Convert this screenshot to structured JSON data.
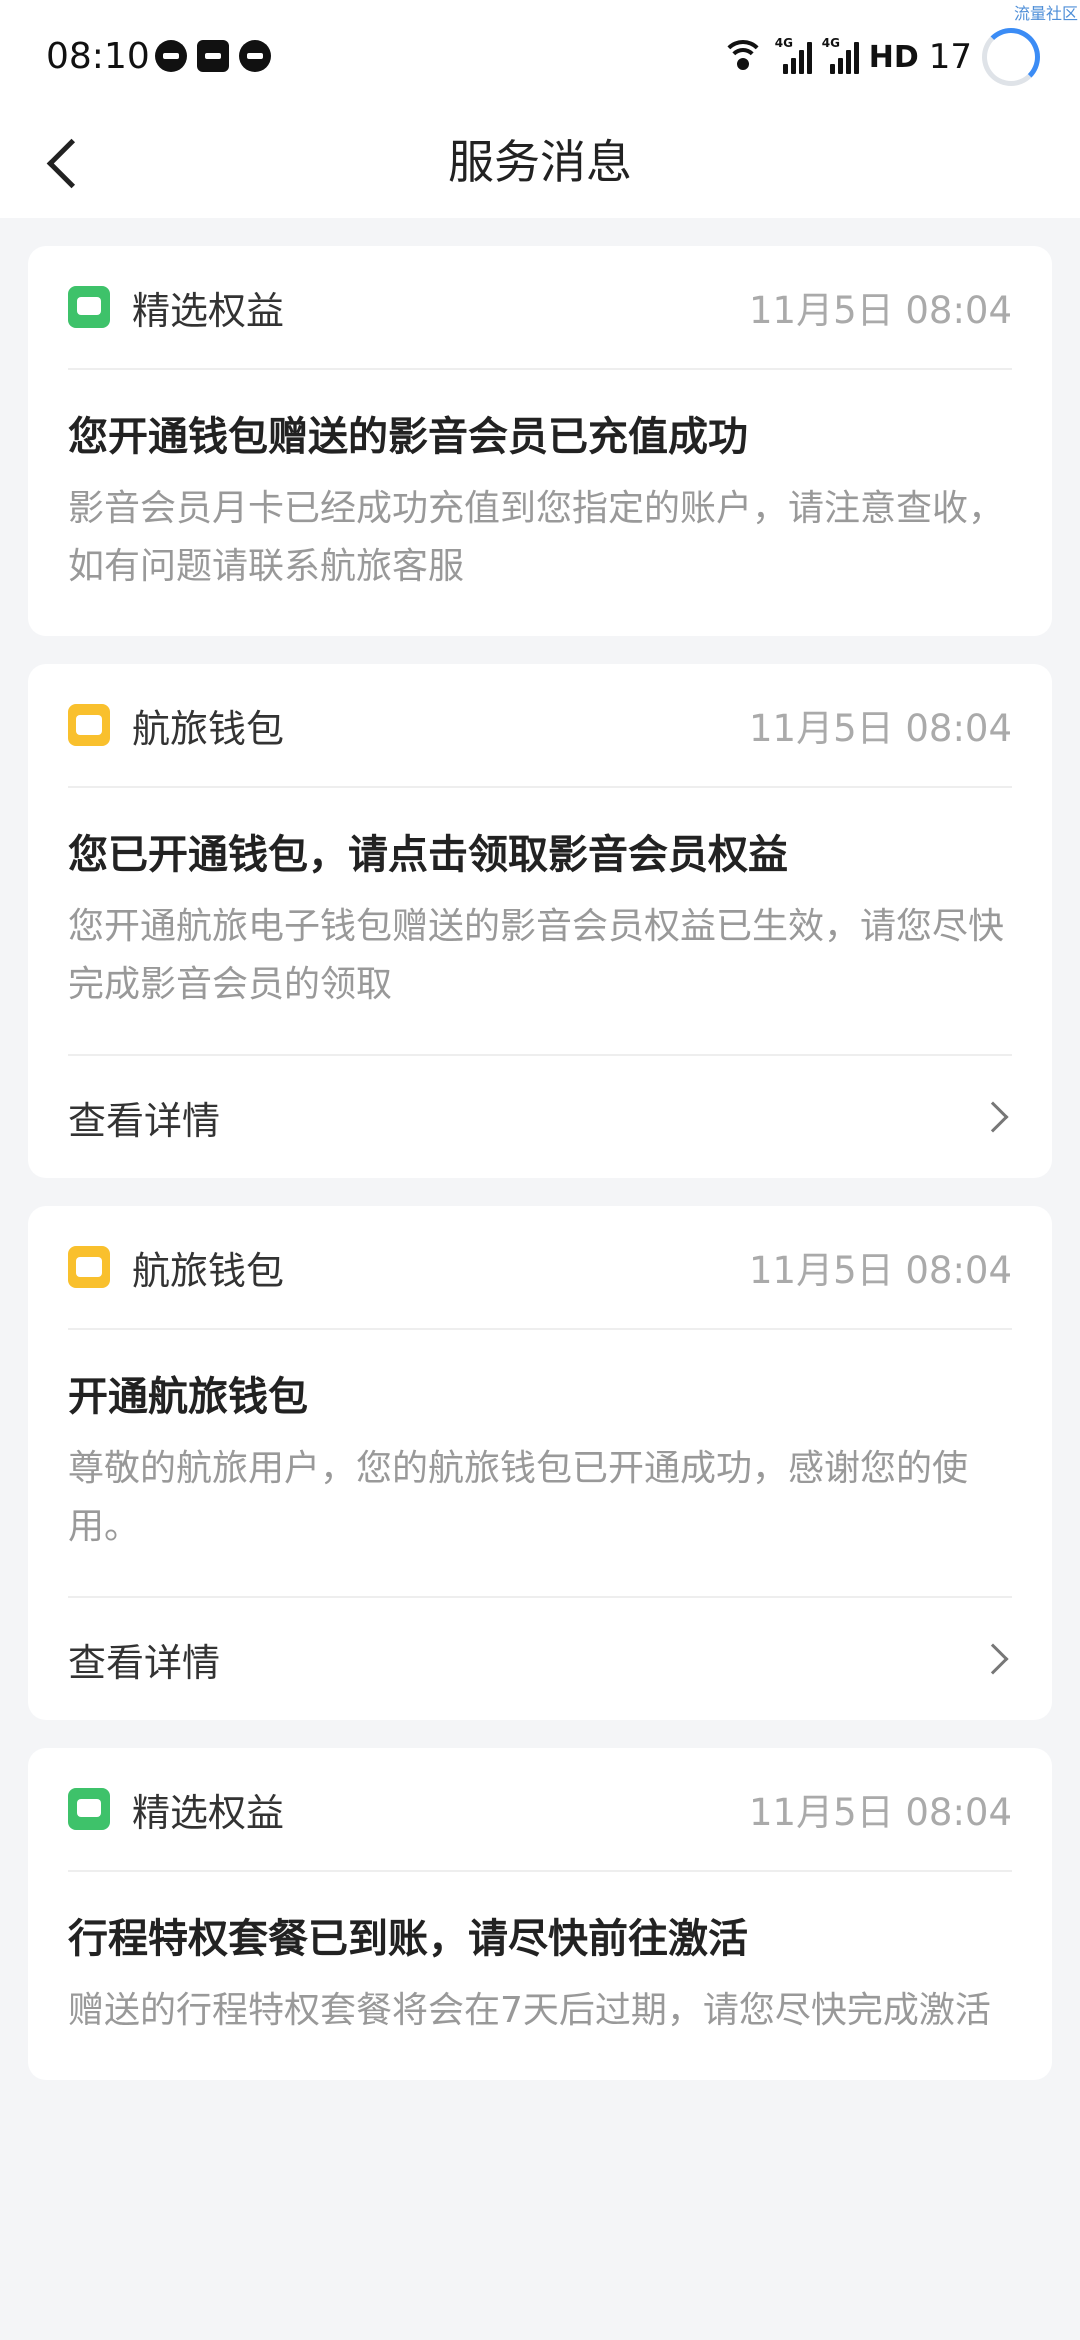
{
  "status_bar": {
    "time": "08:10",
    "hd_label": "HD",
    "battery": "17",
    "net_tags": [
      "4G",
      "4G"
    ],
    "watermark": "流量社区"
  },
  "nav": {
    "title": "服务消息"
  },
  "messages": [
    {
      "source": "精选权益",
      "icon": "green-chat-icon",
      "time": "11月5日 08:04",
      "title": "您开通钱包赠送的影音会员已充值成功",
      "text": "影音会员月卡已经成功充值到您指定的账户，请注意查收，如有问题请联系航旅客服"
    },
    {
      "source": "航旅钱包",
      "icon": "yellow-wallet-icon",
      "time": "11月5日 08:04",
      "title": "您已开通钱包，请点击领取影音会员权益",
      "text": "您开通航旅电子钱包赠送的影音会员权益已生效，请您尽快完成影音会员的领取",
      "detail_label": "查看详情"
    },
    {
      "source": "航旅钱包",
      "icon": "yellow-wallet-icon",
      "time": "11月5日 08:04",
      "title": "开通航旅钱包",
      "text": "尊敬的航旅用户，您的航旅钱包已开通成功，感谢您的使用。",
      "detail_label": "查看详情"
    },
    {
      "source": "精选权益",
      "icon": "green-chat-icon",
      "time": "11月5日 08:04",
      "title": "行程特权套餐已到账，请尽快前往激活",
      "text": "赠送的行程特权套餐将会在7天后过期，请您尽快完成激活"
    }
  ]
}
